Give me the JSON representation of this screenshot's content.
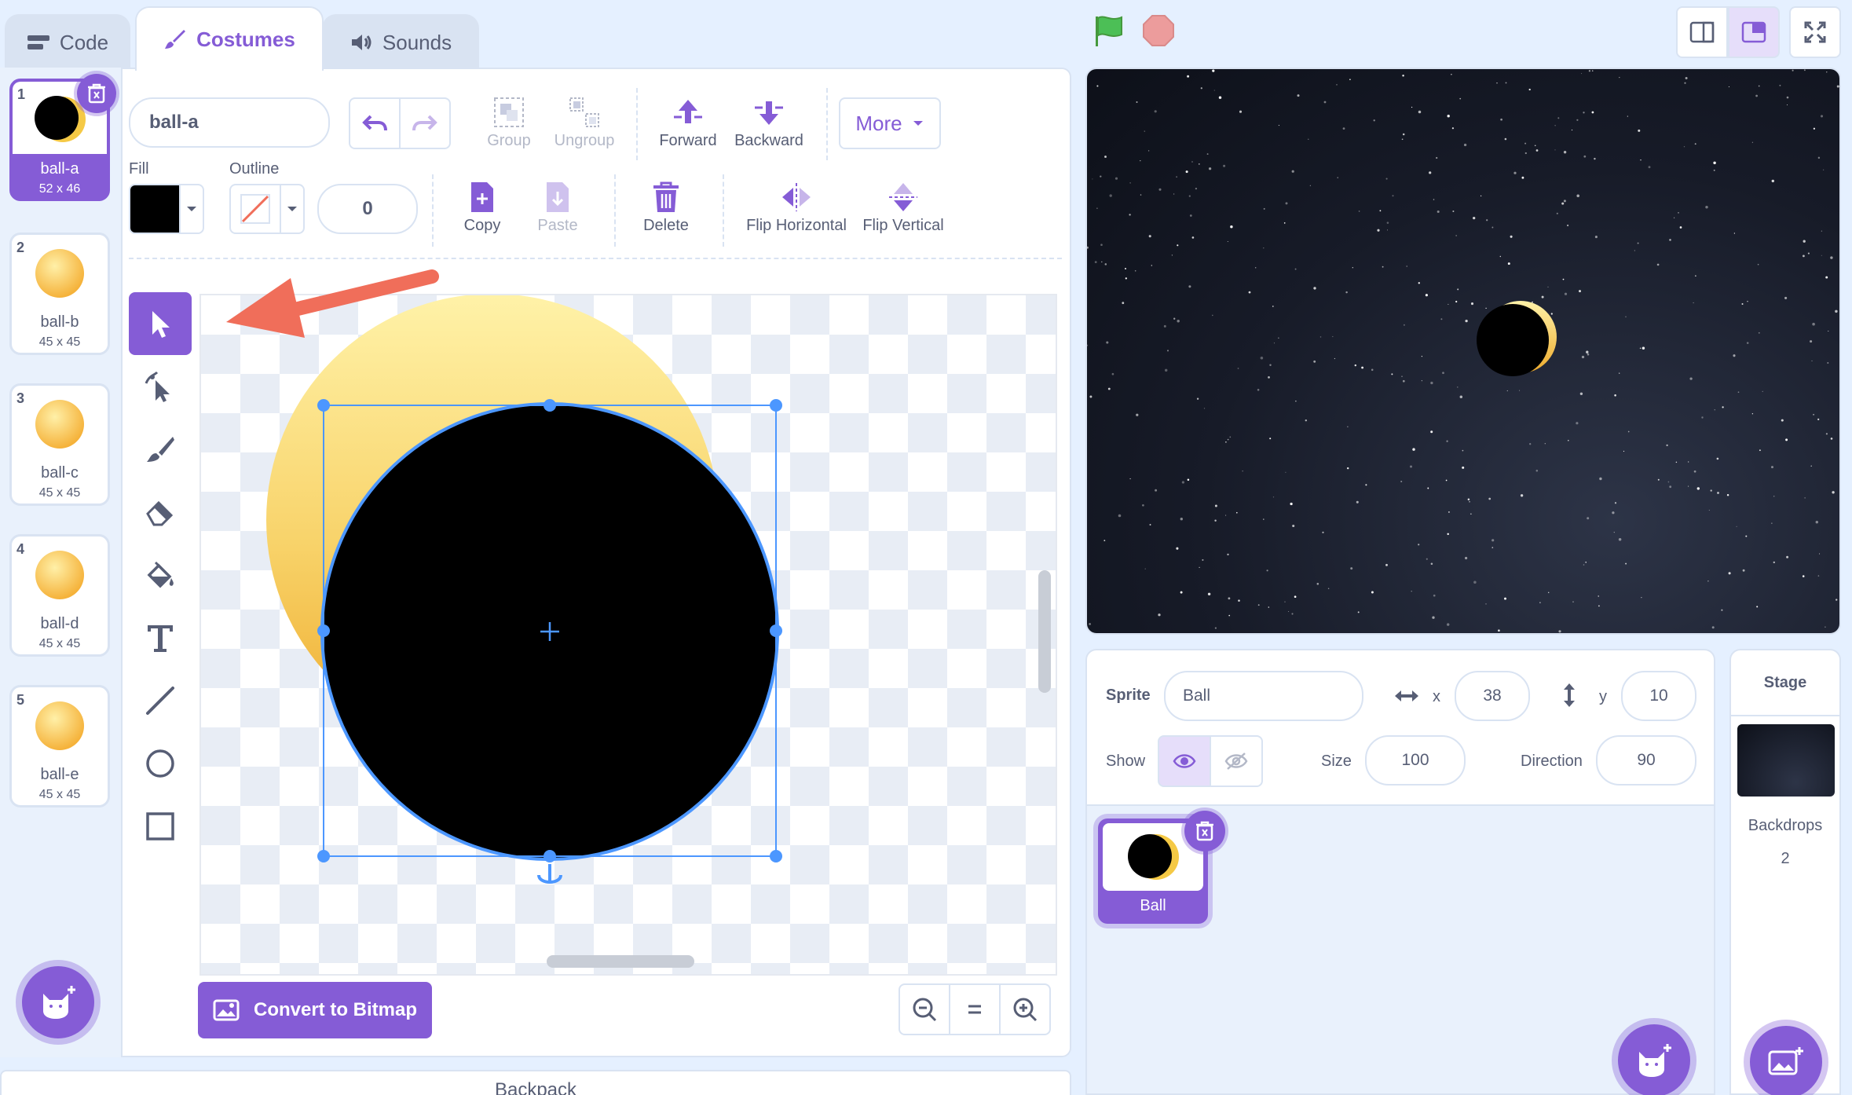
{
  "tabs": {
    "code": "Code",
    "costumes": "Costumes",
    "sounds": "Sounds"
  },
  "costumes": [
    {
      "num": "1",
      "name": "ball-a",
      "size": "52 x 46",
      "selected": true
    },
    {
      "num": "2",
      "name": "ball-b",
      "size": "45 x 45"
    },
    {
      "num": "3",
      "name": "ball-c",
      "size": "45 x 45"
    },
    {
      "num": "4",
      "name": "ball-d",
      "size": "45 x 45"
    },
    {
      "num": "5",
      "name": "ball-e",
      "size": "45 x 45"
    }
  ],
  "paint": {
    "costume_name": "ball-a",
    "fill_label": "Fill",
    "outline_label": "Outline",
    "outline_width": "0",
    "group": "Group",
    "ungroup": "Ungroup",
    "forward": "Forward",
    "backward": "Backward",
    "more": "More",
    "copy": "Copy",
    "paste": "Paste",
    "delete": "Delete",
    "flip_h": "Flip Horizontal",
    "flip_v": "Flip Vertical",
    "convert": "Convert to Bitmap",
    "backpack": "Backpack"
  },
  "colors": {
    "accent": "#855cd6",
    "fill": "#000000",
    "selection": "#4c97ff",
    "arrow": "#f06e5a"
  },
  "sprite": {
    "label": "Sprite",
    "name": "Ball",
    "x_label": "x",
    "x": "38",
    "y_label": "y",
    "y": "10",
    "show_label": "Show",
    "size_label": "Size",
    "size": "100",
    "direction_label": "Direction",
    "direction": "90",
    "tile_name": "Ball"
  },
  "stage_pane": {
    "title": "Stage",
    "backdrops_label": "Backdrops",
    "backdrops_count": "2"
  }
}
